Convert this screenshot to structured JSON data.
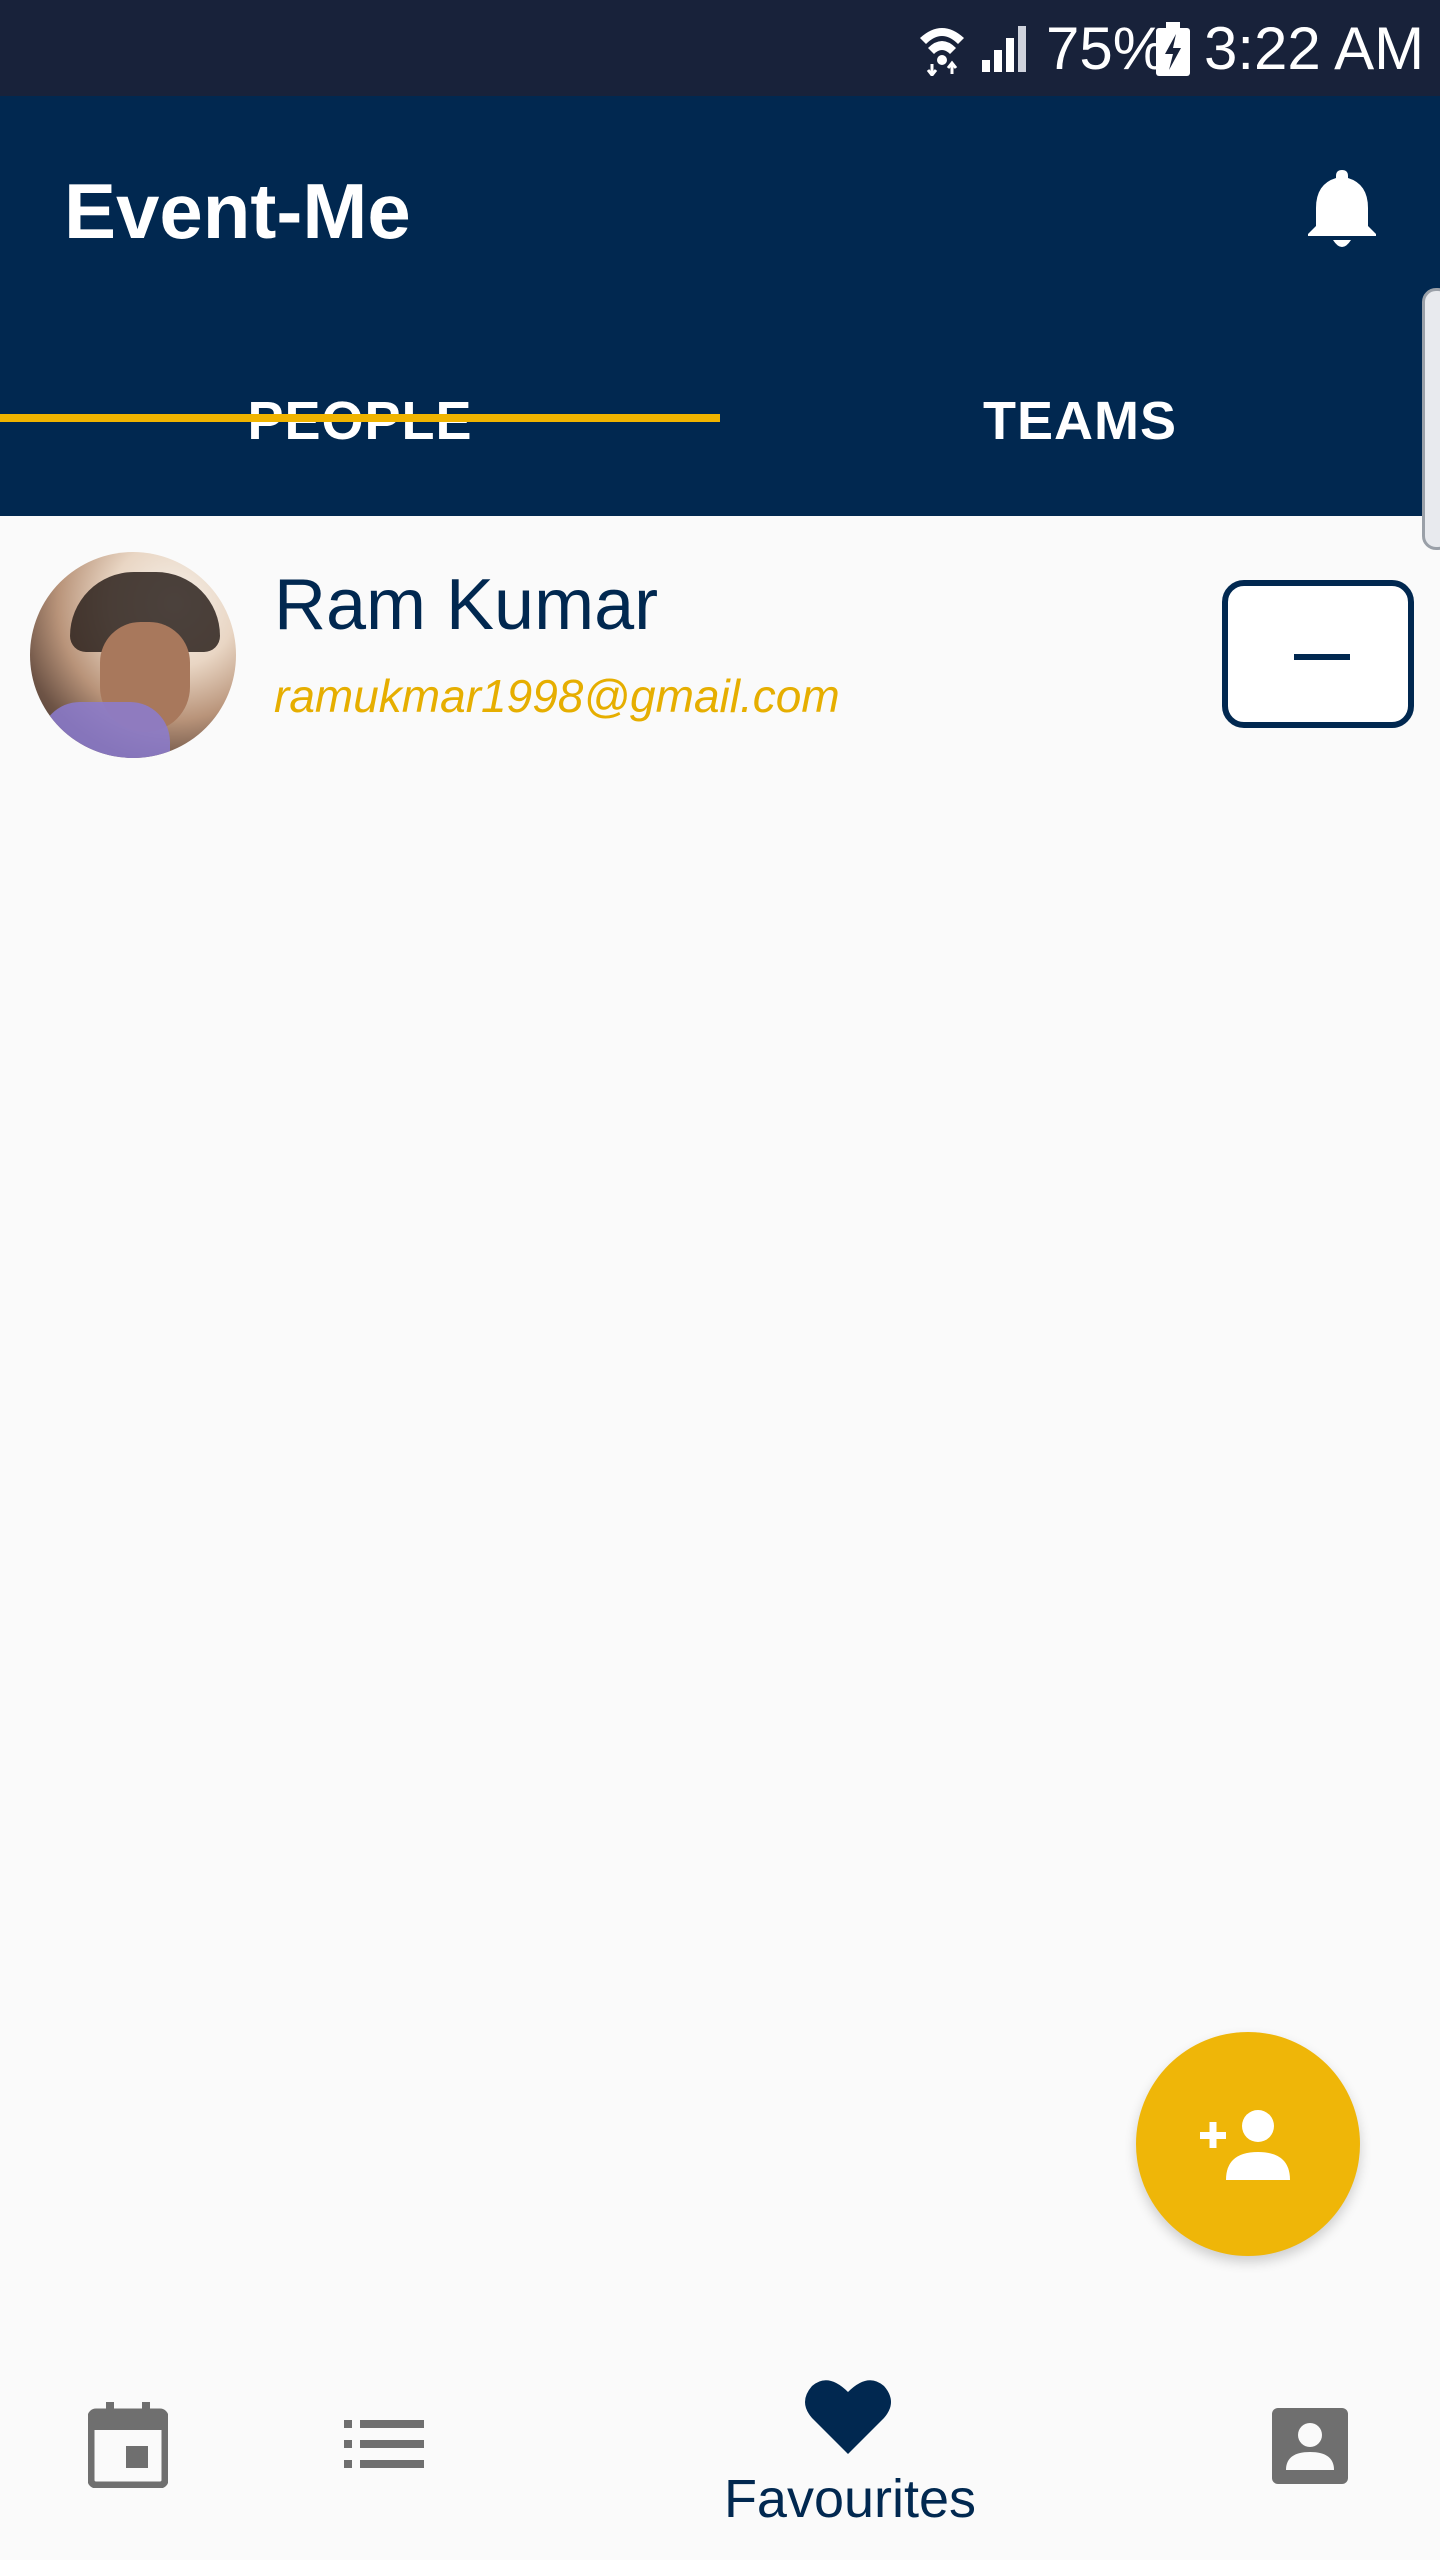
{
  "status_bar": {
    "battery_percent": "75%",
    "time": "3:22 AM",
    "icons": [
      "wifi-icon",
      "cell-signal-icon",
      "battery-charging-icon"
    ]
  },
  "app_bar": {
    "title": "Event-Me",
    "notification_icon": "bell-icon"
  },
  "tabs": {
    "items": [
      {
        "label": "PEOPLE",
        "selected": true
      },
      {
        "label": "TEAMS",
        "selected": false
      }
    ],
    "indicator_color": "#f0b400"
  },
  "people": [
    {
      "name": "Ram Kumar",
      "email": "ramukmar1998@gmail.com",
      "action_icon": "minus-icon"
    }
  ],
  "fab": {
    "icon": "add-person-icon",
    "color": "#efb608"
  },
  "bottom_nav": {
    "items": [
      {
        "icon": "calendar-icon",
        "label": ""
      },
      {
        "icon": "list-icon",
        "label": ""
      },
      {
        "icon": "heart-icon",
        "label": "Favourites",
        "selected": true
      },
      {
        "icon": "account-box-icon",
        "label": ""
      }
    ]
  },
  "colors": {
    "primary": "#012850",
    "accent": "#efb608",
    "status_bar": "#18223a",
    "background": "#fafafa"
  }
}
